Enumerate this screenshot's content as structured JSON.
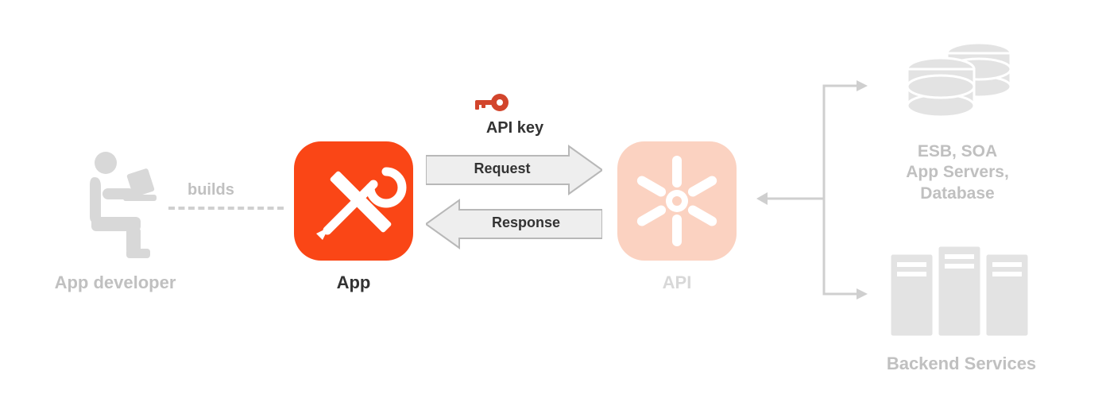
{
  "labels": {
    "app_developer": "App developer",
    "builds": "builds",
    "app": "App",
    "api_key": "API key",
    "request": "Request",
    "response": "Response",
    "api": "API",
    "esb_line1": "ESB, SOA",
    "esb_line2": "App Servers,",
    "esb_line3": "Database",
    "backend_services": "Backend Services"
  },
  "colors": {
    "orange": "#fa4616",
    "light_orange": "#fbd2c1",
    "key_red": "#d2452c",
    "faded": "#c0c0c0",
    "dark": "#333333",
    "arrow_fill": "#eeeeee",
    "arrow_stroke": "#b8b8b8"
  }
}
